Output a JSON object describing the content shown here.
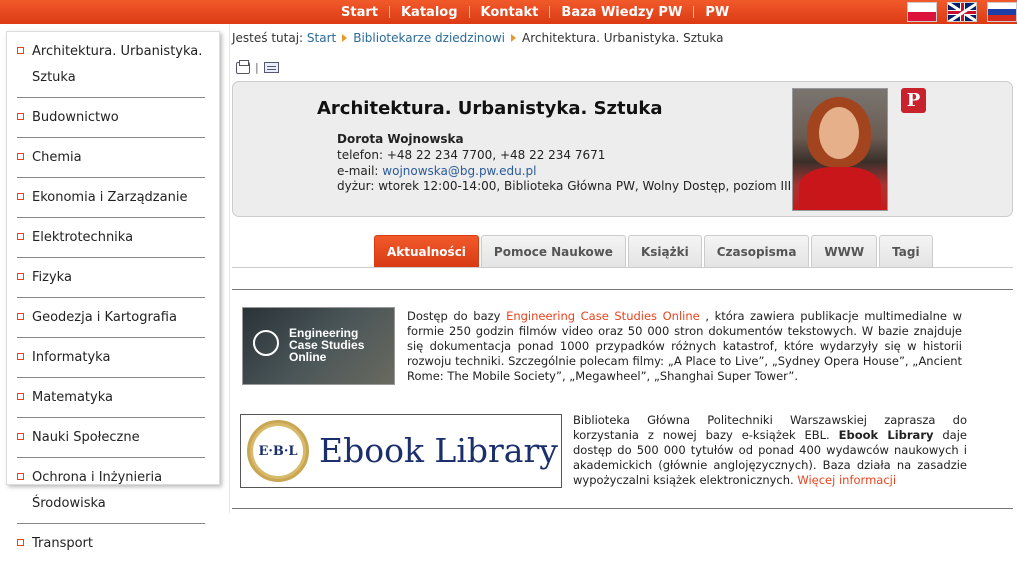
{
  "topnav": [
    "Start",
    "Katalog",
    "Kontakt",
    "Baza Wiedzy PW",
    "PW"
  ],
  "flags": [
    "flag-pl-icon",
    "flag-gb-icon",
    "flag-ru-icon"
  ],
  "sidebar": {
    "items": [
      "Architektura. Urbanistyka. Sztuka",
      "Budownictwo",
      "Chemia",
      "Ekonomia i Zarządzanie",
      "Elektrotechnika",
      "Fizyka",
      "Geodezja i Kartografia",
      "Informatyka",
      "Matematyka",
      "Nauki Społeczne",
      "Ochrona i Inżynieria Środowiska",
      "Transport"
    ]
  },
  "breadcrumb": {
    "prefix": "Jesteś tutaj:",
    "items": [
      "Start",
      "Bibliotekarze dziedzinowi",
      "Architektura. Urbanistyka. Sztuka"
    ]
  },
  "tools": {
    "separator": "|"
  },
  "profile": {
    "title": "Architektura. Urbanistyka. Sztuka",
    "name": "Dorota Wojnowska",
    "phone": "telefon: +48 22 234 7700, +48 22 234 7671",
    "email_label": "e-mail:",
    "email": "wojnowska@bg.pw.edu.pl",
    "duty": "dyżur: wtorek 12:00-14:00, Biblioteka Główna PW, Wolny Dostęp, poziom III",
    "pinterest": "P"
  },
  "tabs": [
    "Aktualności",
    "Pomoce Naukowe",
    "Książki",
    "Czasopisma",
    "WWW",
    "Tagi"
  ],
  "news": [
    {
      "image_text": [
        "Engineering",
        "Case Studies",
        "Online"
      ],
      "before": "Dostęp do bazy ",
      "link": "Engineering Case Studies Online",
      "after": " , która zawiera publikacje multimedialne w formie 250 godzin filmów video oraz 50 000 stron dokumentów tekstowych. W bazie znajduje się dokumentacja ponad 1000 przypadków różnych katastrof, które wydarzyły się w historii rozwoju techniki. Szczególnie polecam filmy: „A Place to Live”, „Sydney Opera House”, „Ancient Rome: The Mobile Society”, „Megawheel”, „Shanghai Super Tower”."
    },
    {
      "badge": "E·B·L",
      "logo_text": "Ebook Library",
      "before": "Biblioteka Główna Politechniki Warszawskiej zaprasza do korzystania z nowej bazy e-książek EBL. ",
      "bold": "Ebook Library",
      "after": " daje dostęp do 500 000 tytułów od ponad 400 wydawców naukowych i akademickich (głównie anglojęzycznych). Baza działa na zasadzie wypożyczalni książek elektronicznych. ",
      "more": "Więcej informacji"
    }
  ]
}
